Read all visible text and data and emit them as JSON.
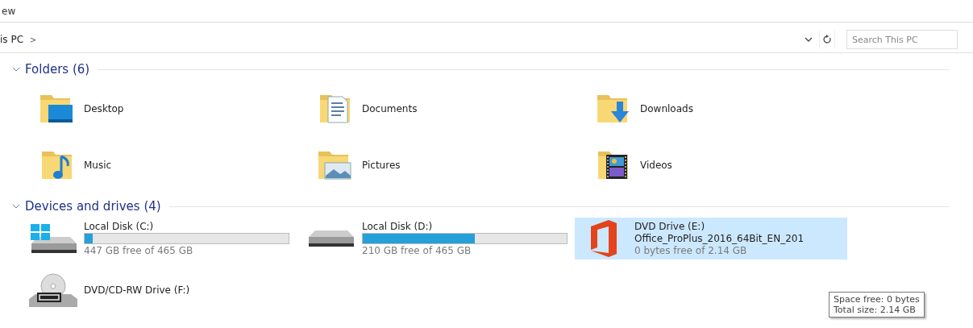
{
  "ribbon": {
    "tab_fragment": "ew"
  },
  "address_bar": {
    "path": "is PC",
    "separator": ">"
  },
  "search": {
    "placeholder": "Search This PC"
  },
  "groups": [
    {
      "title": "Folders (6)",
      "expanded": true,
      "kind": "folders",
      "items": [
        {
          "label": "Desktop",
          "kind": "desktop"
        },
        {
          "label": "Documents",
          "kind": "documents"
        },
        {
          "label": "Downloads",
          "kind": "downloads"
        },
        {
          "label": "Music",
          "kind": "music"
        },
        {
          "label": "Pictures",
          "kind": "pictures"
        },
        {
          "label": "Videos",
          "kind": "videos"
        }
      ]
    },
    {
      "title": "Devices and drives (4)",
      "expanded": true,
      "kind": "drives",
      "items": [
        {
          "label": "Local Disk (C:)",
          "kind": "system",
          "level": 0.04,
          "space": "447 GB free of 465 GB",
          "selected": false
        },
        {
          "label": "Local Disk (D:)",
          "kind": "disk",
          "level": 0.55,
          "space": "210 GB free of 465 GB",
          "selected": false
        },
        {
          "label": "DVD Drive (E:)",
          "kind": "office",
          "volume": "Office_ProPlus_2016_64Bit_EN_201",
          "space": "0 bytes free of 2.14 GB",
          "selected": true
        },
        {
          "label": "DVD/CD-RW Drive (F:)",
          "kind": "dvd",
          "selected": false
        }
      ]
    }
  ],
  "tooltip": {
    "lines": [
      "Space free: 0 bytes",
      "Total size: 2.14 GB"
    ]
  }
}
